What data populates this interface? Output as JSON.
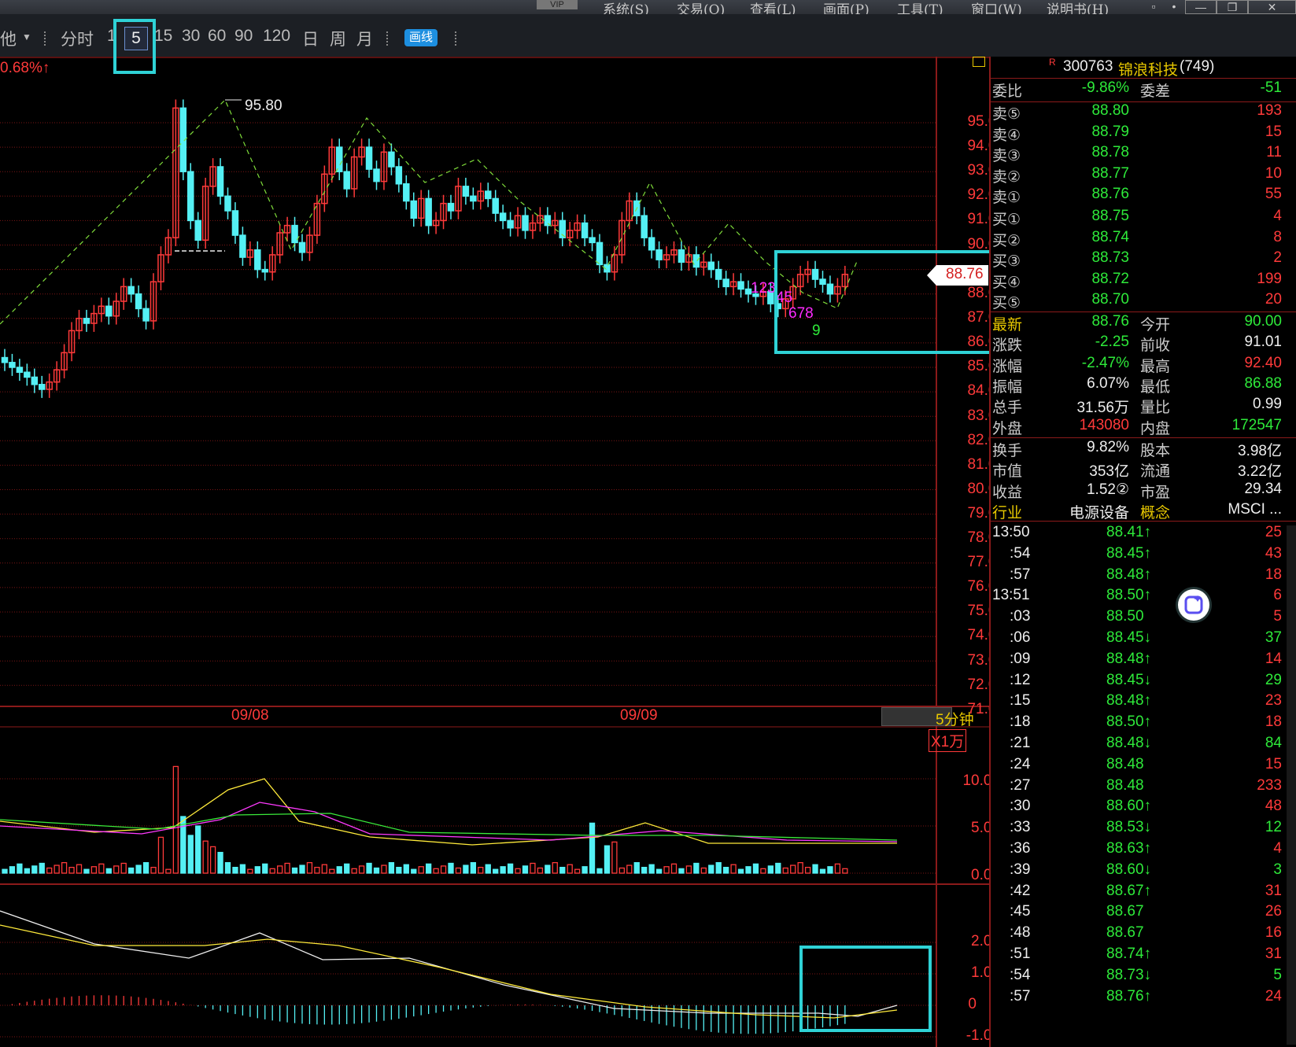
{
  "menubar": {
    "vip": "VIP",
    "items": [
      "系统(S)",
      "交易(Q)",
      "查看(L)",
      "画面(P)",
      "工具(T)",
      "窗口(W)",
      "说明书(H)"
    ]
  },
  "toolbar": {
    "left_label": "他",
    "periods": [
      "分时",
      "1",
      "5",
      "15",
      "30",
      "60",
      "90",
      "120",
      "日",
      "周",
      "月"
    ],
    "selected_period": "5",
    "draw_label": "画线"
  },
  "chart": {
    "pct_change": "0.68%↑",
    "high_label": "95.80",
    "price_axis": [
      "95.00",
      "94.00",
      "93.00",
      "92.00",
      "91.00",
      "90.00",
      "88.00",
      "87.00",
      "86.00",
      "85.00",
      "84.00",
      "83.00",
      "82.00",
      "81.00",
      "80.00",
      "79.00",
      "78.00",
      "77.00",
      "76.00",
      "75.00",
      "74.00",
      "73.00",
      "72.00",
      "71.00"
    ],
    "current_price_tag": "88.76",
    "dates": [
      "09/08",
      "09/09"
    ],
    "period_label": "5分钟",
    "volume_unit": "X1万",
    "volume_axis": [
      "10.00",
      "5.00",
      "0.00"
    ],
    "macd_axis": [
      "2.00",
      "1.00",
      "0",
      "-1.00"
    ],
    "td_counts": [
      "123",
      "45",
      "678",
      "9"
    ]
  },
  "quote": {
    "code": "300763",
    "name": "锦浪科技",
    "count": "(749)",
    "wb_label": "委比",
    "wb_value": "-9.86%",
    "wc_label": "委差",
    "wc_value": "-51",
    "sell": [
      {
        "label": "卖⑤",
        "price": "88.80",
        "vol": "193"
      },
      {
        "label": "卖④",
        "price": "88.79",
        "vol": "15"
      },
      {
        "label": "卖③",
        "price": "88.78",
        "vol": "11"
      },
      {
        "label": "卖②",
        "price": "88.77",
        "vol": "10"
      },
      {
        "label": "卖①",
        "price": "88.76",
        "vol": "55"
      }
    ],
    "buy": [
      {
        "label": "买①",
        "price": "88.75",
        "vol": "4"
      },
      {
        "label": "买②",
        "price": "88.74",
        "vol": "8"
      },
      {
        "label": "买③",
        "price": "88.73",
        "vol": "2"
      },
      {
        "label": "买④",
        "price": "88.72",
        "vol": "199"
      },
      {
        "label": "买⑤",
        "price": "88.70",
        "vol": "20"
      }
    ],
    "stats": [
      {
        "l1": "最新",
        "v1": "88.76",
        "c1": "grn",
        "l2": "今开",
        "v2": "90.00",
        "c2": "grn"
      },
      {
        "l1": "涨跌",
        "v1": "-2.25",
        "c1": "grn",
        "l2": "前收",
        "v2": "91.01",
        "c2": "wht"
      },
      {
        "l1": "涨幅",
        "v1": "-2.47%",
        "c1": "grn",
        "l2": "最高",
        "v2": "92.40",
        "c2": "red"
      },
      {
        "l1": "振幅",
        "v1": "6.07%",
        "c1": "wht",
        "l2": "最低",
        "v2": "86.88",
        "c2": "grn"
      },
      {
        "l1": "总手",
        "v1": "31.56万",
        "c1": "wht",
        "l2": "量比",
        "v2": "0.99",
        "c2": "wht"
      },
      {
        "l1": "外盘",
        "v1": "143080",
        "c1": "red",
        "l2": "内盘",
        "v2": "172547",
        "c2": "grn"
      }
    ],
    "stats2": [
      {
        "l1": "换手",
        "v1": "9.82%",
        "l2": "股本",
        "v2": "3.98亿"
      },
      {
        "l1": "市值",
        "v1": "353亿",
        "l2": "流通",
        "v2": "3.22亿"
      },
      {
        "l1": "收益",
        "v1": "1.52②",
        "l2": "市盈",
        "v2": "29.34"
      },
      {
        "l1": "行业",
        "v1": "电源设备",
        "l2": "概念",
        "v2": "MSCI ..."
      }
    ],
    "ticks": [
      {
        "t": "13:50",
        "p": "88.41↑",
        "v": "25",
        "vc": "red"
      },
      {
        "t": ":54",
        "p": "88.45↑",
        "v": "43",
        "vc": "red"
      },
      {
        "t": ":57",
        "p": "88.48↑",
        "v": "18",
        "vc": "red"
      },
      {
        "t": "13:51",
        "p": "88.50↑",
        "v": "6",
        "vc": "red"
      },
      {
        "t": ":03",
        "p": "88.50",
        "v": "5",
        "vc": "red"
      },
      {
        "t": ":06",
        "p": "88.45↓",
        "v": "37",
        "vc": "grn"
      },
      {
        "t": ":09",
        "p": "88.48↑",
        "v": "14",
        "vc": "red"
      },
      {
        "t": ":12",
        "p": "88.45↓",
        "v": "29",
        "vc": "grn"
      },
      {
        "t": ":15",
        "p": "88.48↑",
        "v": "23",
        "vc": "red"
      },
      {
        "t": ":18",
        "p": "88.50↑",
        "v": "18",
        "vc": "red"
      },
      {
        "t": ":21",
        "p": "88.48↓",
        "v": "84",
        "vc": "grn"
      },
      {
        "t": ":24",
        "p": "88.48",
        "v": "15",
        "vc": "red"
      },
      {
        "t": ":27",
        "p": "88.48",
        "v": "233",
        "vc": "red"
      },
      {
        "t": ":30",
        "p": "88.60↑",
        "v": "48",
        "vc": "red"
      },
      {
        "t": ":33",
        "p": "88.53↓",
        "v": "12",
        "vc": "grn"
      },
      {
        "t": ":36",
        "p": "88.63↑",
        "v": "4",
        "vc": "red"
      },
      {
        "t": ":39",
        "p": "88.60↓",
        "v": "3",
        "vc": "grn"
      },
      {
        "t": ":42",
        "p": "88.67↑",
        "v": "31",
        "vc": "red"
      },
      {
        "t": ":45",
        "p": "88.67",
        "v": "26",
        "vc": "red"
      },
      {
        "t": ":48",
        "p": "88.67",
        "v": "16",
        "vc": "red"
      },
      {
        "t": ":51",
        "p": "88.74↑",
        "v": "31",
        "vc": "red"
      },
      {
        "t": ":54",
        "p": "88.73↓",
        "v": "5",
        "vc": "grn"
      },
      {
        "t": ":57",
        "p": "88.76↑",
        "v": "24",
        "vc": "red"
      }
    ]
  },
  "colors": {
    "up": "#ff3a3a",
    "down": "#54f0f4",
    "highlight": "#2fd2d6",
    "grid": "#7a1515"
  }
}
